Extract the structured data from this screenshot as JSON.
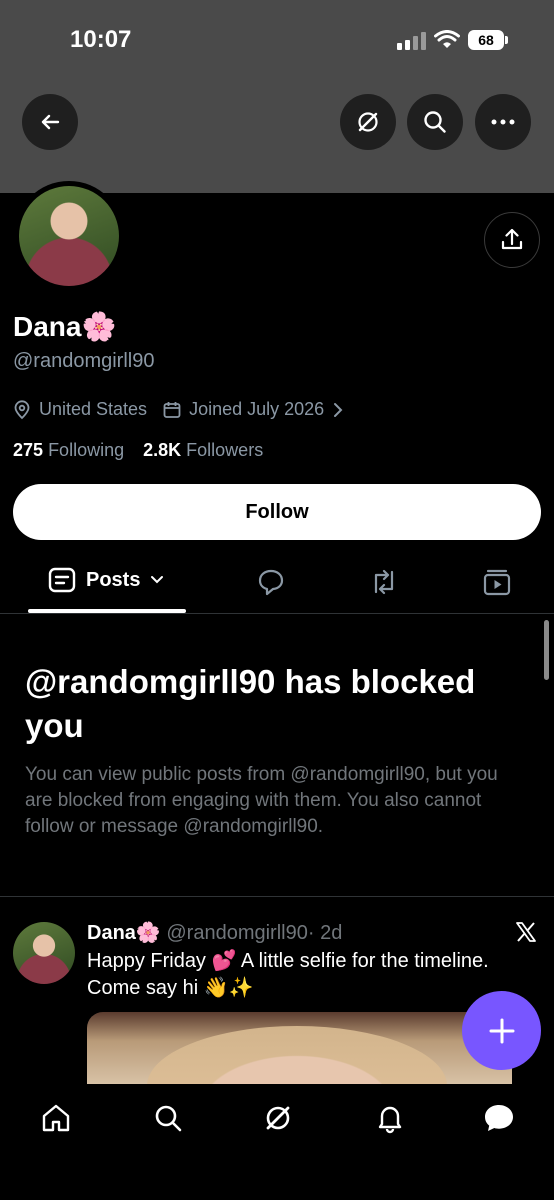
{
  "status_bar": {
    "time": "10:07",
    "battery": "68"
  },
  "header": {
    "back_icon": "arrow-left-icon",
    "grok_icon": "grok-icon",
    "search_icon": "search-icon",
    "more_icon": "more-horizontal-icon"
  },
  "profile": {
    "name": "Dana",
    "name_emoji": "🌸",
    "handle": "@randomgirll90",
    "location": "United States",
    "joined": "Joined July 2026",
    "following_count": "275",
    "following_label": "Following",
    "followers_count": "2.8K",
    "followers_label": "Followers",
    "follow_button": "Follow"
  },
  "tabs": {
    "posts_label": "Posts"
  },
  "blocked": {
    "title": "@randomgirll90 has blocked you",
    "body": "You can view public posts from @randomgirll90, but you are blocked from engaging with them. You also cannot follow or message @randomgirll90."
  },
  "post": {
    "author_name": "Dana",
    "author_emoji": "🌸",
    "author_handle": "@randomgirll90",
    "time": "· 2d",
    "text_line1": "Happy Friday 💕 A little selfie for the timeline.",
    "text_line2": "Come say hi 👋✨"
  },
  "fab": {
    "icon": "plus-icon"
  },
  "colors": {
    "accent": "#7856ff",
    "muted": "#71767b",
    "banner": "#4a4a4a"
  }
}
